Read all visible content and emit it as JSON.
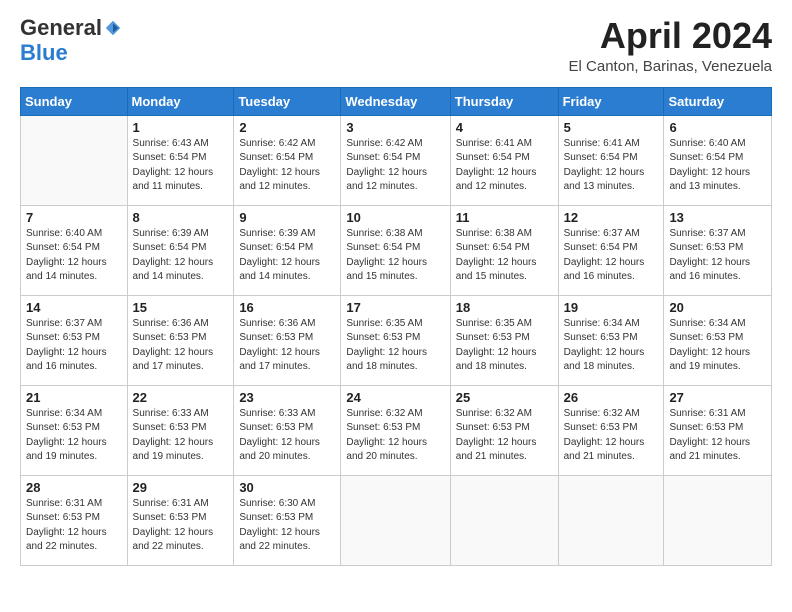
{
  "logo": {
    "general": "General",
    "blue": "Blue"
  },
  "header": {
    "month": "April 2024",
    "location": "El Canton, Barinas, Venezuela"
  },
  "weekdays": [
    "Sunday",
    "Monday",
    "Tuesday",
    "Wednesday",
    "Thursday",
    "Friday",
    "Saturday"
  ],
  "weeks": [
    [
      {
        "day": "",
        "sunrise": "",
        "sunset": "",
        "daylight": ""
      },
      {
        "day": "1",
        "sunrise": "Sunrise: 6:43 AM",
        "sunset": "Sunset: 6:54 PM",
        "daylight": "Daylight: 12 hours and 11 minutes."
      },
      {
        "day": "2",
        "sunrise": "Sunrise: 6:42 AM",
        "sunset": "Sunset: 6:54 PM",
        "daylight": "Daylight: 12 hours and 12 minutes."
      },
      {
        "day": "3",
        "sunrise": "Sunrise: 6:42 AM",
        "sunset": "Sunset: 6:54 PM",
        "daylight": "Daylight: 12 hours and 12 minutes."
      },
      {
        "day": "4",
        "sunrise": "Sunrise: 6:41 AM",
        "sunset": "Sunset: 6:54 PM",
        "daylight": "Daylight: 12 hours and 12 minutes."
      },
      {
        "day": "5",
        "sunrise": "Sunrise: 6:41 AM",
        "sunset": "Sunset: 6:54 PM",
        "daylight": "Daylight: 12 hours and 13 minutes."
      },
      {
        "day": "6",
        "sunrise": "Sunrise: 6:40 AM",
        "sunset": "Sunset: 6:54 PM",
        "daylight": "Daylight: 12 hours and 13 minutes."
      }
    ],
    [
      {
        "day": "7",
        "sunrise": "Sunrise: 6:40 AM",
        "sunset": "Sunset: 6:54 PM",
        "daylight": "Daylight: 12 hours and 14 minutes."
      },
      {
        "day": "8",
        "sunrise": "Sunrise: 6:39 AM",
        "sunset": "Sunset: 6:54 PM",
        "daylight": "Daylight: 12 hours and 14 minutes."
      },
      {
        "day": "9",
        "sunrise": "Sunrise: 6:39 AM",
        "sunset": "Sunset: 6:54 PM",
        "daylight": "Daylight: 12 hours and 14 minutes."
      },
      {
        "day": "10",
        "sunrise": "Sunrise: 6:38 AM",
        "sunset": "Sunset: 6:54 PM",
        "daylight": "Daylight: 12 hours and 15 minutes."
      },
      {
        "day": "11",
        "sunrise": "Sunrise: 6:38 AM",
        "sunset": "Sunset: 6:54 PM",
        "daylight": "Daylight: 12 hours and 15 minutes."
      },
      {
        "day": "12",
        "sunrise": "Sunrise: 6:37 AM",
        "sunset": "Sunset: 6:54 PM",
        "daylight": "Daylight: 12 hours and 16 minutes."
      },
      {
        "day": "13",
        "sunrise": "Sunrise: 6:37 AM",
        "sunset": "Sunset: 6:53 PM",
        "daylight": "Daylight: 12 hours and 16 minutes."
      }
    ],
    [
      {
        "day": "14",
        "sunrise": "Sunrise: 6:37 AM",
        "sunset": "Sunset: 6:53 PM",
        "daylight": "Daylight: 12 hours and 16 minutes."
      },
      {
        "day": "15",
        "sunrise": "Sunrise: 6:36 AM",
        "sunset": "Sunset: 6:53 PM",
        "daylight": "Daylight: 12 hours and 17 minutes."
      },
      {
        "day": "16",
        "sunrise": "Sunrise: 6:36 AM",
        "sunset": "Sunset: 6:53 PM",
        "daylight": "Daylight: 12 hours and 17 minutes."
      },
      {
        "day": "17",
        "sunrise": "Sunrise: 6:35 AM",
        "sunset": "Sunset: 6:53 PM",
        "daylight": "Daylight: 12 hours and 18 minutes."
      },
      {
        "day": "18",
        "sunrise": "Sunrise: 6:35 AM",
        "sunset": "Sunset: 6:53 PM",
        "daylight": "Daylight: 12 hours and 18 minutes."
      },
      {
        "day": "19",
        "sunrise": "Sunrise: 6:34 AM",
        "sunset": "Sunset: 6:53 PM",
        "daylight": "Daylight: 12 hours and 18 minutes."
      },
      {
        "day": "20",
        "sunrise": "Sunrise: 6:34 AM",
        "sunset": "Sunset: 6:53 PM",
        "daylight": "Daylight: 12 hours and 19 minutes."
      }
    ],
    [
      {
        "day": "21",
        "sunrise": "Sunrise: 6:34 AM",
        "sunset": "Sunset: 6:53 PM",
        "daylight": "Daylight: 12 hours and 19 minutes."
      },
      {
        "day": "22",
        "sunrise": "Sunrise: 6:33 AM",
        "sunset": "Sunset: 6:53 PM",
        "daylight": "Daylight: 12 hours and 19 minutes."
      },
      {
        "day": "23",
        "sunrise": "Sunrise: 6:33 AM",
        "sunset": "Sunset: 6:53 PM",
        "daylight": "Daylight: 12 hours and 20 minutes."
      },
      {
        "day": "24",
        "sunrise": "Sunrise: 6:32 AM",
        "sunset": "Sunset: 6:53 PM",
        "daylight": "Daylight: 12 hours and 20 minutes."
      },
      {
        "day": "25",
        "sunrise": "Sunrise: 6:32 AM",
        "sunset": "Sunset: 6:53 PM",
        "daylight": "Daylight: 12 hours and 21 minutes."
      },
      {
        "day": "26",
        "sunrise": "Sunrise: 6:32 AM",
        "sunset": "Sunset: 6:53 PM",
        "daylight": "Daylight: 12 hours and 21 minutes."
      },
      {
        "day": "27",
        "sunrise": "Sunrise: 6:31 AM",
        "sunset": "Sunset: 6:53 PM",
        "daylight": "Daylight: 12 hours and 21 minutes."
      }
    ],
    [
      {
        "day": "28",
        "sunrise": "Sunrise: 6:31 AM",
        "sunset": "Sunset: 6:53 PM",
        "daylight": "Daylight: 12 hours and 22 minutes."
      },
      {
        "day": "29",
        "sunrise": "Sunrise: 6:31 AM",
        "sunset": "Sunset: 6:53 PM",
        "daylight": "Daylight: 12 hours and 22 minutes."
      },
      {
        "day": "30",
        "sunrise": "Sunrise: 6:30 AM",
        "sunset": "Sunset: 6:53 PM",
        "daylight": "Daylight: 12 hours and 22 minutes."
      },
      {
        "day": "",
        "sunrise": "",
        "sunset": "",
        "daylight": ""
      },
      {
        "day": "",
        "sunrise": "",
        "sunset": "",
        "daylight": ""
      },
      {
        "day": "",
        "sunrise": "",
        "sunset": "",
        "daylight": ""
      },
      {
        "day": "",
        "sunrise": "",
        "sunset": "",
        "daylight": ""
      }
    ]
  ]
}
